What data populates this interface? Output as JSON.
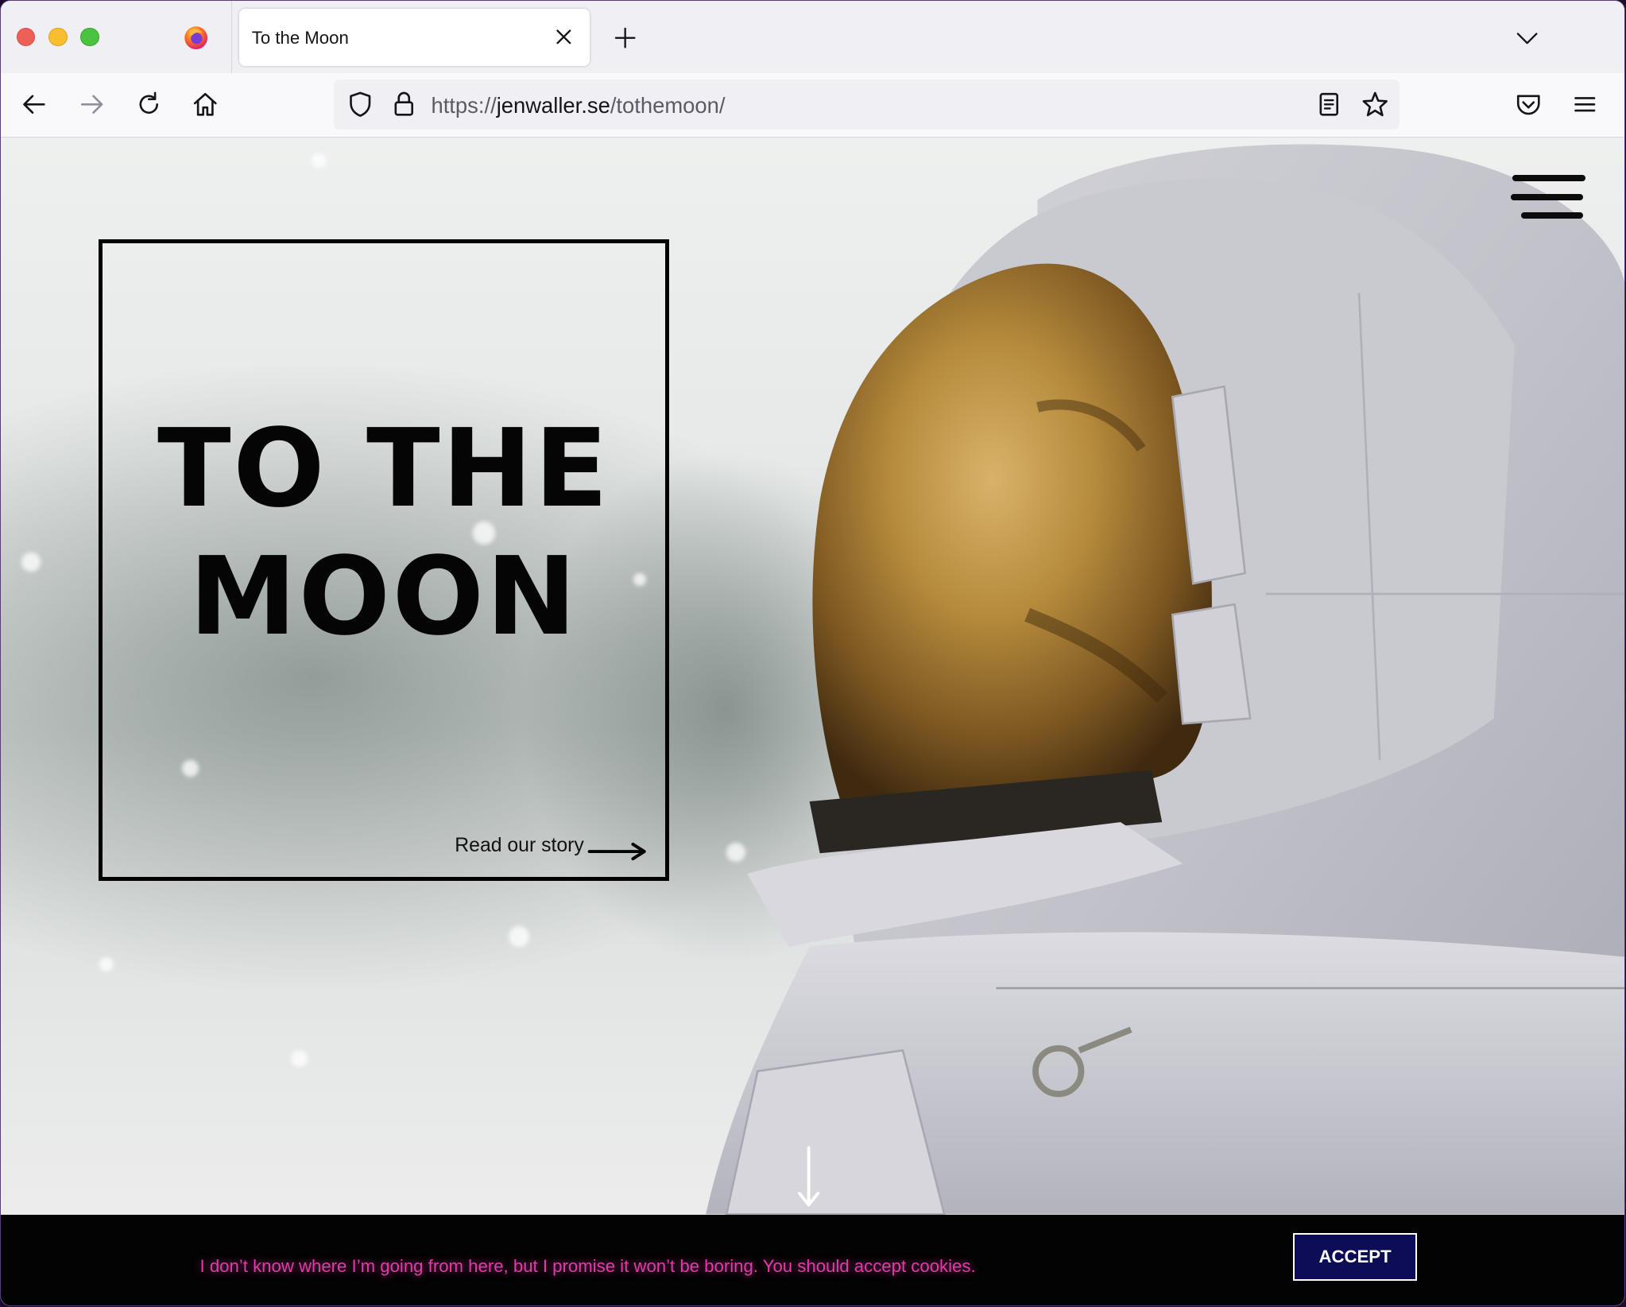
{
  "browser": {
    "tab_title": "To the Moon",
    "url_scheme": "https://",
    "url_host": "jenwaller.se",
    "url_path": "/tothemoon/"
  },
  "hero": {
    "title_line1": "TO THE",
    "title_line2": "MOON",
    "read_story": "Read our story"
  },
  "cookie": {
    "message": "I don’t know where I’m going from here, but I promise it won’t be boring. You should accept cookies.",
    "accept_label": "ACCEPT"
  },
  "colors": {
    "cookie_text": "#e23ba8",
    "accept_bg": "#0d0d57",
    "hero_border": "#000000"
  },
  "icons": {
    "nav": [
      "back-icon",
      "forward-icon",
      "reload-icon",
      "home-icon"
    ],
    "urlbar": [
      "shield-icon",
      "lock-icon",
      "reader-view-icon",
      "bookmark-star-icon"
    ],
    "toolbar": [
      "pocket-icon",
      "app-menu-icon"
    ]
  }
}
